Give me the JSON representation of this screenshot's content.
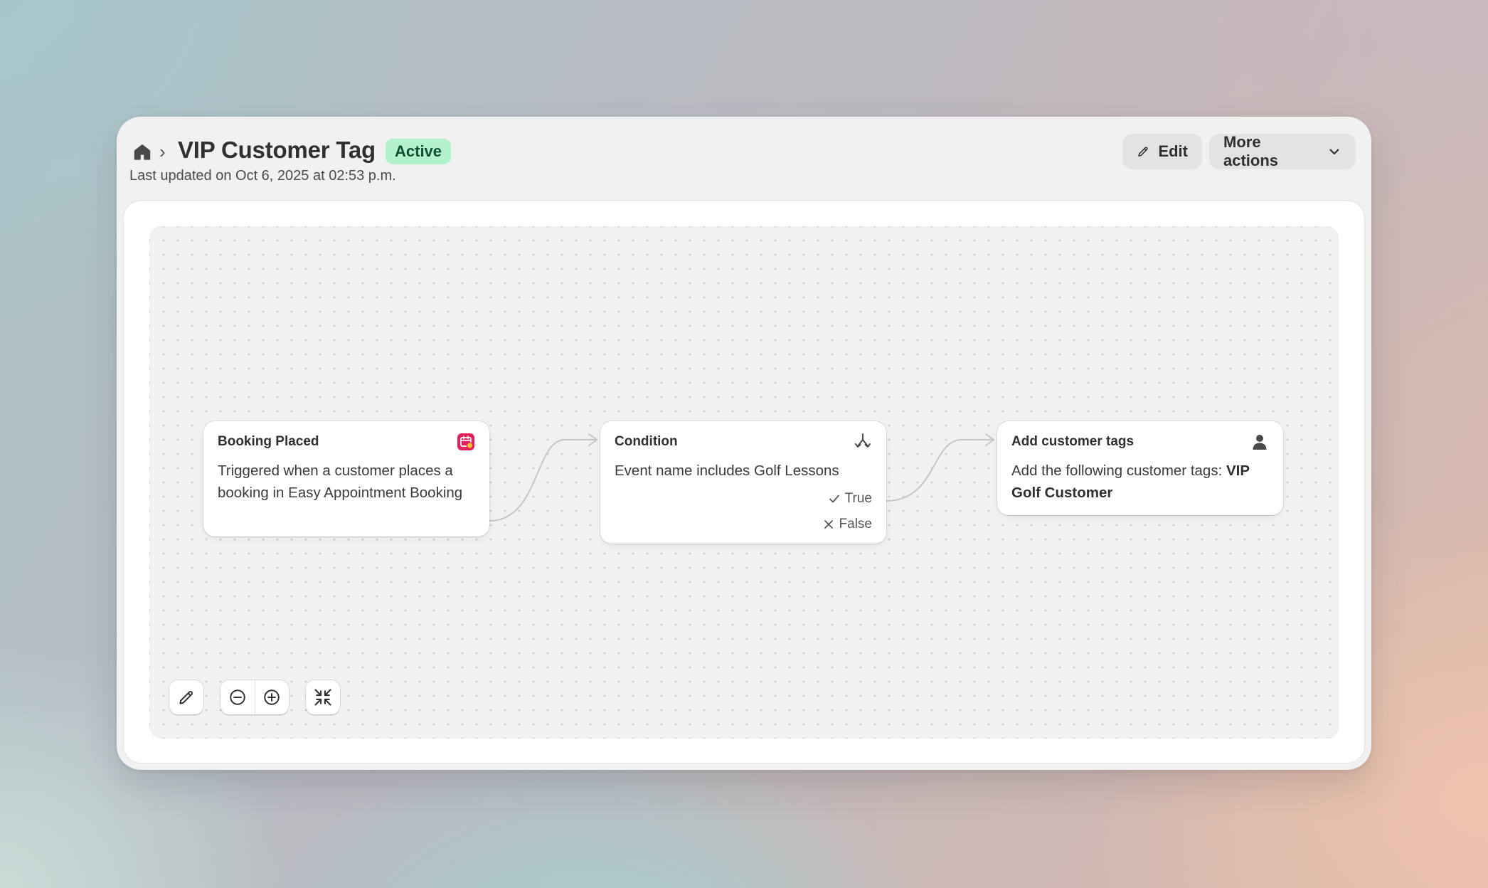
{
  "header": {
    "home_icon": "home-icon",
    "breadcrumb_separator": "›",
    "title": "VIP Customer Tag",
    "status": "Active",
    "last_updated": "Last updated on Oct 6, 2025 at 02:53 p.m.",
    "edit_label": "Edit",
    "more_actions_label": "More actions"
  },
  "workflow": {
    "trigger": {
      "title": "Booking Placed",
      "description": "Triggered when a customer places a booking in Easy Appointment Booking",
      "icon": "calendar-app-icon"
    },
    "condition": {
      "title": "Condition",
      "description": "Event name includes Golf Lessons",
      "icon": "branch-icon",
      "branch_true": "True",
      "branch_false": "False"
    },
    "action": {
      "title": "Add customer tags",
      "description_prefix": "Add the following customer tags: ",
      "tag_value": "VIP Golf Customer",
      "icon": "person-icon"
    }
  },
  "canvas_controls": [
    "edit-icon",
    "zoom-out-icon",
    "zoom-in-icon",
    "fit-view-icon"
  ],
  "colors": {
    "badge_bg": "#b4f2cd",
    "badge_text": "#0c5132",
    "trigger_icon": "#e3225c",
    "button_bg": "#e3e3e3"
  }
}
